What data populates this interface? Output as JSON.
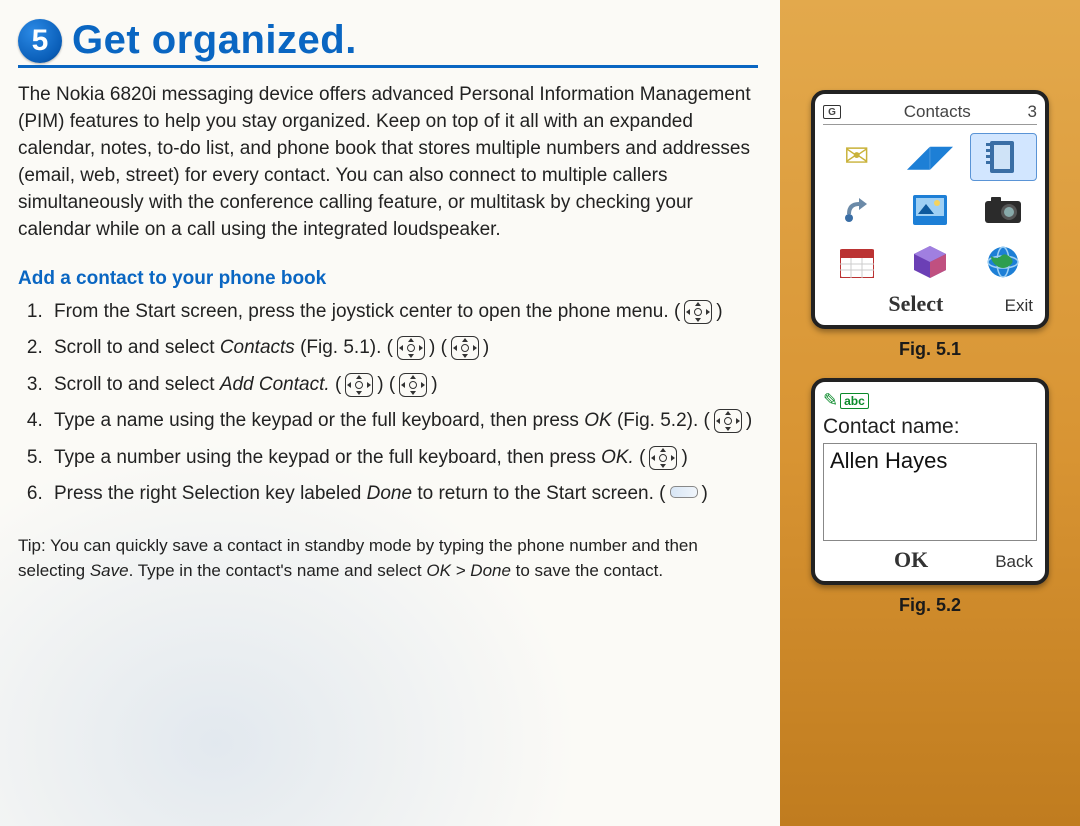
{
  "chapter_number": "5",
  "chapter_title": "Get organized.",
  "intro": "The Nokia 6820i messaging device offers advanced Personal Information Management (PIM) features to help you stay organized. Keep on top of it all with an expanded calendar, notes, to-do list, and phone book that stores multiple numbers and addresses (email, web, street) for every contact. You can also connect to multiple callers simultaneously with the conference calling feature, or multitask by checking your calendar while on a call using the integrated loudspeaker.",
  "section_heading": "Add a contact to your phone book",
  "steps": {
    "s1": "From the Start screen, press the joystick center to open the phone menu.",
    "s2_a": "Scroll to and select ",
    "s2_i": "Contacts",
    "s2_b": " (Fig. 5.1).",
    "s3_a": "Scroll to and select ",
    "s3_i": "Add Contact.",
    "s4_a": "Type a name using the keypad or the full keyboard, then press ",
    "s4_i": "OK",
    "s4_b": " (Fig. 5.2).",
    "s5_a": "Type a number using the keypad or the full keyboard, then press ",
    "s5_i": "OK.",
    "s6_a": "Press the right Selection key labeled ",
    "s6_i": "Done",
    "s6_b": " to return to the Start screen."
  },
  "tip_a": "Tip: You can quickly save a contact in standby mode by typing the phone number and then selecting ",
  "tip_i1": "Save",
  "tip_b": ". Type in the contact's name and select ",
  "tip_i2": "OK > Done",
  "tip_c": " to save the contact.",
  "fig1": {
    "caption": "Fig. 5.1",
    "signal": "G",
    "title": "Contacts",
    "batt": "3",
    "softkey_center": "Select",
    "softkey_right": "Exit",
    "icons": {
      "messages": "messages-icon",
      "call": "call-register-icon",
      "contacts": "contacts-icon",
      "settings": "settings-icon",
      "gallery": "gallery-icon",
      "camera": "camera-icon",
      "calendar": "calendar-icon",
      "extras": "extras-icon",
      "web": "web-icon"
    }
  },
  "fig2": {
    "caption": "Fig. 5.2",
    "mode": "abc",
    "label": "Contact name:",
    "value": "Allen Hayes",
    "softkey_center": "OK",
    "softkey_right": "Back"
  }
}
